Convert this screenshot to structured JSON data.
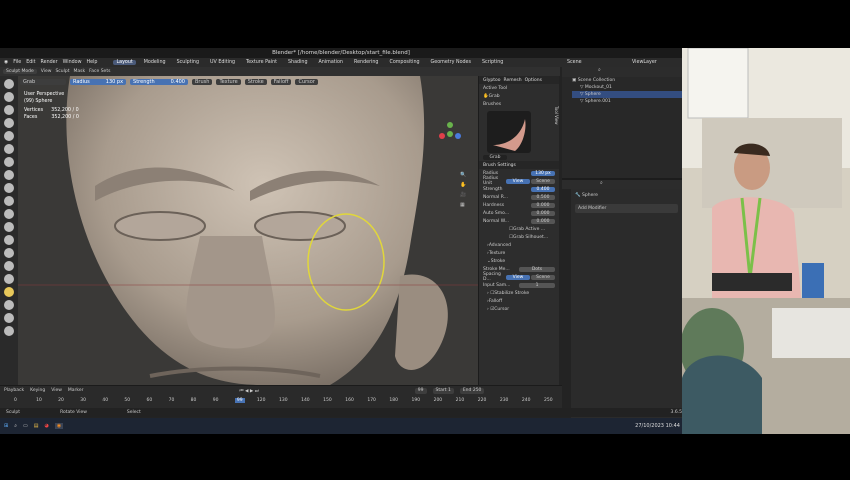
{
  "window": {
    "title": "Blender* [/home/blender/Desktop/start_file.blend]"
  },
  "menu": [
    "File",
    "Edit",
    "Render",
    "Window",
    "Help"
  ],
  "workspaces": [
    {
      "label": "Layout",
      "active": true
    },
    {
      "label": "Modeling",
      "active": false
    },
    {
      "label": "Sculpting",
      "active": false
    },
    {
      "label": "UV Editing",
      "active": false
    },
    {
      "label": "Texture Paint",
      "active": false
    },
    {
      "label": "Shading",
      "active": false
    },
    {
      "label": "Animation",
      "active": false
    },
    {
      "label": "Rendering",
      "active": false
    },
    {
      "label": "Compositing",
      "active": false
    },
    {
      "label": "Geometry Nodes",
      "active": false
    },
    {
      "label": "Scripting",
      "active": false
    }
  ],
  "top_right": {
    "scene": "Scene",
    "view_layer": "ViewLayer"
  },
  "header": {
    "mode": "Sculpt Mode",
    "menus": [
      "View",
      "Sculpt",
      "Mask",
      "Face Sets"
    ],
    "tool": "Grab",
    "radius_label": "Radius",
    "radius_value": "130 px",
    "strength_label": "Strength",
    "strength_value": "0.400",
    "dropdowns": [
      "Brush",
      "Texture",
      "Stroke",
      "Falloff",
      "Cursor"
    ]
  },
  "viewport_overlay": {
    "line1": "User Perspective",
    "line2": "(99) Sphere",
    "vertices_label": "Vertices",
    "vertices_value": "352,200 / 0",
    "faces_label": "Faces",
    "faces_value": "352,200 / 0"
  },
  "npanel": {
    "header_right": [
      "Glyptoo",
      "Remesh",
      "Options"
    ],
    "active_tool": "Active Tool",
    "tool_name": "Grab",
    "brushes": "Brushes",
    "brush_name": "Grab",
    "brush_settings": "Brush Settings",
    "radius_label": "Radius",
    "radius_value": "130 px",
    "radius_unit_label": "Radius Unit",
    "radius_unit_options": [
      "View",
      "Scene"
    ],
    "strength_label": "Strength",
    "strength_value": "0.400",
    "normal_r_label": "Normal R...",
    "normal_r_value": "0.500",
    "hardness_label": "Hardness",
    "hardness_value": "0.000",
    "auto_smo_label": "Auto Smo...",
    "auto_smo_value": "0.000",
    "normal_w_label": "Normal W...",
    "normal_w_value": "0.000",
    "grab_active": "Grab Active ...",
    "grab_silhouette": "Grab Silhouet...",
    "advanced": "Advanced",
    "texture": "Texture",
    "stroke": "Stroke",
    "stroke_method_label": "Stroke Me...",
    "stroke_method_value": "Dots",
    "spacing_label": "Spacing D...",
    "spacing_options": [
      "View",
      "Scene"
    ],
    "input_samples_label": "Input Sam...",
    "input_samples_value": "1",
    "stabilize": "Stabilize Stroke",
    "falloff": "Falloff",
    "cursor": "Cursor",
    "tabs": [
      "Tool",
      "View"
    ]
  },
  "outliner": {
    "scene_collection": "Scene Collection",
    "items": [
      "Mockout_01",
      "Sphere",
      "Sphere.001"
    ]
  },
  "properties": {
    "object": "Sphere",
    "add_modifier": "Add Modifier"
  },
  "timeline": {
    "menus": [
      "Playback",
      "Keying",
      "View",
      "Marker"
    ],
    "current_frame": "99",
    "start_label": "Start",
    "start_value": "1",
    "end_label": "End",
    "end_value": "250",
    "ticks": [
      "0",
      "10",
      "20",
      "30",
      "40",
      "50",
      "60",
      "70",
      "80",
      "90",
      "99",
      "120",
      "130",
      "140",
      "150",
      "160",
      "170",
      "180",
      "190",
      "200",
      "210",
      "220",
      "230",
      "240",
      "250"
    ]
  },
  "statusbar": {
    "left": "Sculpt",
    "middle": "Rotate View",
    "right": "Select",
    "version": "3.6.5"
  },
  "taskbar": {
    "datetime": "27/10/2023 10:44"
  }
}
